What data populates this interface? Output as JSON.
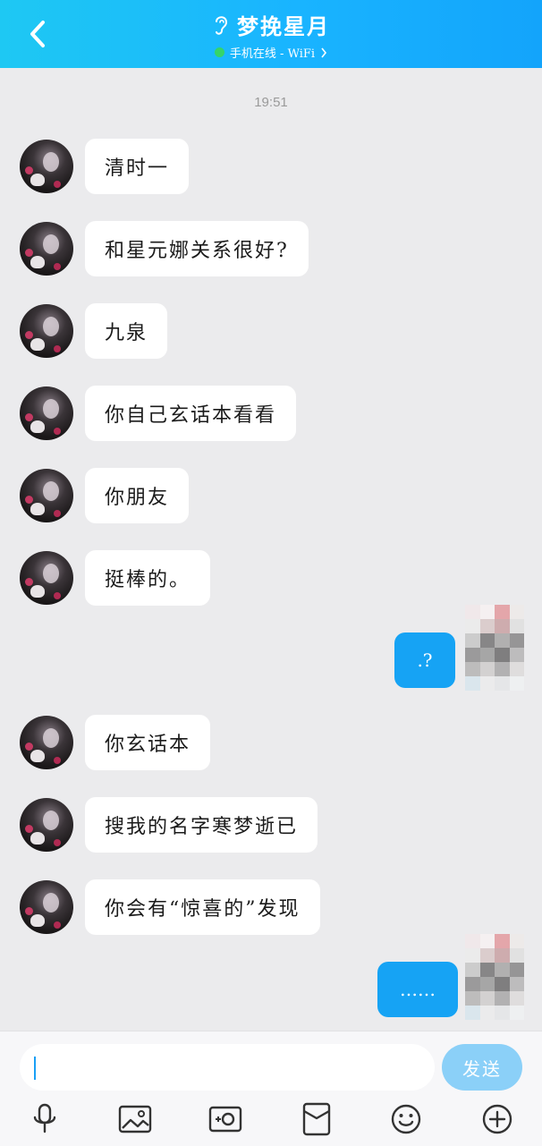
{
  "header": {
    "title": "梦挽星月",
    "status": "手机在线 - WiFi",
    "status_color": "#35d46a"
  },
  "timestamp": "19:51",
  "messages": [
    {
      "side": "in",
      "text": "清时一"
    },
    {
      "side": "in",
      "text": "和星元娜关系很好?"
    },
    {
      "side": "in",
      "text": "九泉"
    },
    {
      "side": "in",
      "text": "你自己玄话本看看"
    },
    {
      "side": "in",
      "text": "你朋友"
    },
    {
      "side": "in",
      "text": "挺棒的。"
    },
    {
      "side": "out",
      "text": ".?"
    },
    {
      "side": "in",
      "text": "你玄话本"
    },
    {
      "side": "in",
      "text": "搜我的名字寒梦逝已"
    },
    {
      "side": "in",
      "text": "你会有“惊喜的”发现"
    },
    {
      "side": "out",
      "text": "……"
    }
  ],
  "input": {
    "value": "",
    "send_label": "发送"
  },
  "toolbar": [
    "microphone-icon",
    "image-icon",
    "camera-icon",
    "red-envelope-icon",
    "emoji-icon",
    "plus-icon"
  ],
  "colors": {
    "header": "#19b4ff",
    "outgoing_bubble": "#16a3f4",
    "send_button": "#8bd0f8",
    "background": "#ebebed"
  }
}
